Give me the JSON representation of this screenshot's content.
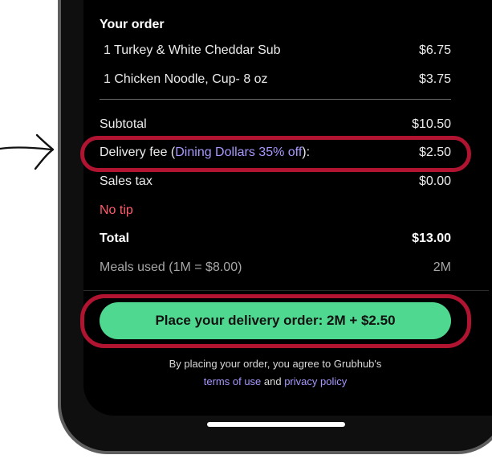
{
  "order": {
    "title": "Your order",
    "items": [
      {
        "name": "1 Turkey & White Cheddar Sub",
        "price": "$6.75"
      },
      {
        "name": "1 Chicken Noodle, Cup- 8 oz",
        "price": "$3.75"
      }
    ]
  },
  "summary": {
    "subtotal_label": "Subtotal",
    "subtotal_value": "$10.50",
    "delivery_label_prefix": "Delivery fee (",
    "delivery_discount": "Dining Dollars 35% off",
    "delivery_label_suffix": "):",
    "delivery_value": "$2.50",
    "tax_label": "Sales tax",
    "tax_value": "$0.00",
    "tip_label": "No tip",
    "total_label": "Total",
    "total_value": "$13.00",
    "meals_label": "Meals used (1M = $8.00)",
    "meals_value": "2M"
  },
  "actions": {
    "place_order_label": "Place your delivery order: 2M + $2.50"
  },
  "legal": {
    "line1": "By placing your order, you agree to Grubhub's",
    "terms_link": "terms of use",
    "and": " and ",
    "privacy_link": "privacy policy"
  },
  "colors": {
    "accent_green": "#4fd88f",
    "highlight_red": "#b01430",
    "link_purple": "#a897ff",
    "no_tip_red": "#ff5c6c"
  }
}
